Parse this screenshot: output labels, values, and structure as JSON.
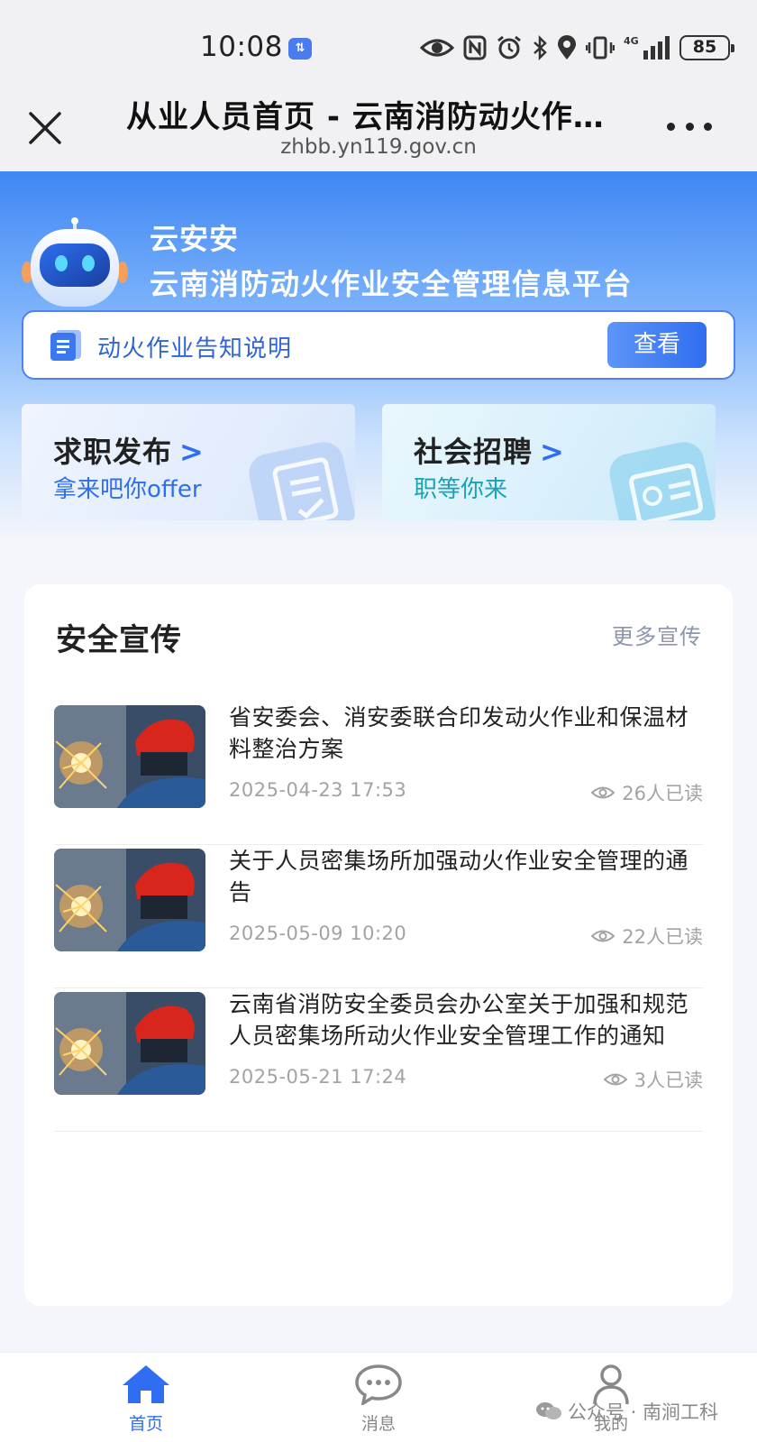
{
  "status_bar": {
    "time": "10:08",
    "data_badge": "⇅",
    "battery": "85",
    "network": "4G"
  },
  "title_bar": {
    "title": "从业人员首页 - 云南消防动火作业安全管理信息平台",
    "url": "zhbb.yn119.gov.cn"
  },
  "hero": {
    "brand_name": "云安安",
    "brand_subtitle": "云南消防动火作业安全管理信息平台",
    "notice_text": "动火作业告知说明",
    "notice_button": "查看",
    "promo_left": {
      "title": "求职发布",
      "arrow": ">",
      "subtitle": "拿来吧你offer"
    },
    "promo_right": {
      "title": "社会招聘",
      "arrow": ">",
      "subtitle": "职等你来"
    }
  },
  "news": {
    "section_title": "安全宣传",
    "more_link": "更多宣传",
    "items": [
      {
        "title": "省安委会、消安委联合印发动火作业和保温材料整治方案",
        "date": "2025-04-23 17:53",
        "reads": "26人已读"
      },
      {
        "title": "关于人员密集场所加强动火作业安全管理的通告",
        "date": "2025-05-09 10:20",
        "reads": "22人已读"
      },
      {
        "title": "云南省消防安全委员会办公室关于加强和规范人员密集场所动火作业安全管理工作的通知",
        "date": "2025-05-21 17:24",
        "reads": "3人已读"
      }
    ]
  },
  "bottom_nav": {
    "items": [
      {
        "label": "首页",
        "icon": "home-icon",
        "active": true
      },
      {
        "label": "消息",
        "icon": "message-icon",
        "active": false
      },
      {
        "label": "我的",
        "icon": "user-icon",
        "active": false
      }
    ]
  },
  "watermark": "公众号 · 南涧工科",
  "colors": {
    "accent": "#2f6ef0",
    "hero_top": "#3f87f4",
    "teal_text": "#18a2b8"
  }
}
